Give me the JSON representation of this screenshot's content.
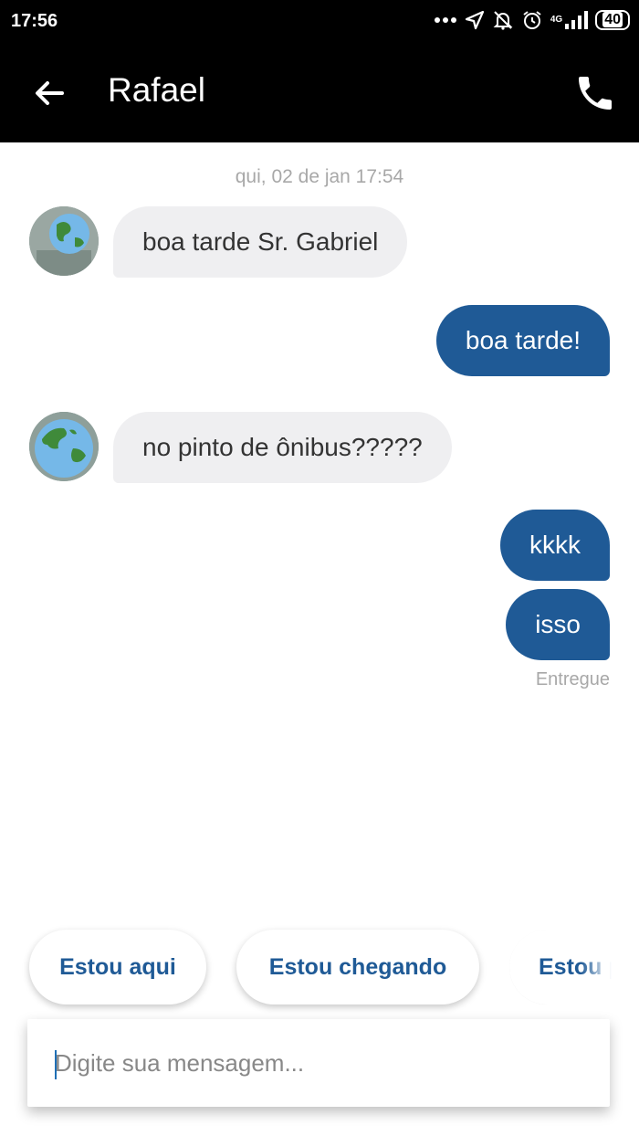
{
  "status_bar": {
    "time": "17:56",
    "network": "4G",
    "battery": "40",
    "icons": [
      "dots-icon",
      "location-icon",
      "muted-bell-icon",
      "alarm-icon",
      "signal-icon",
      "battery-icon"
    ]
  },
  "header": {
    "title": "Rafael",
    "back_icon": "back-arrow-icon",
    "call_icon": "phone-icon"
  },
  "chat": {
    "timestamp": "qui, 02 de jan 17:54",
    "messages": [
      {
        "from": "contact",
        "text": "boa tarde Sr. Gabriel"
      },
      {
        "from": "me",
        "text": "boa tarde!"
      },
      {
        "from": "contact",
        "text": "no pinto de ônibus?????"
      },
      {
        "from": "me",
        "text": "kkkk"
      },
      {
        "from": "me",
        "text": "isso"
      }
    ],
    "delivered_label": "Entregue"
  },
  "quick_replies": [
    "Estou aqui",
    "Estou chegando",
    "Estou pr"
  ],
  "composer": {
    "placeholder": "Digite sua mensagem..."
  },
  "colors": {
    "accent": "#1f5a96",
    "incoming_bubble": "#efeff1",
    "header": "#000000"
  }
}
